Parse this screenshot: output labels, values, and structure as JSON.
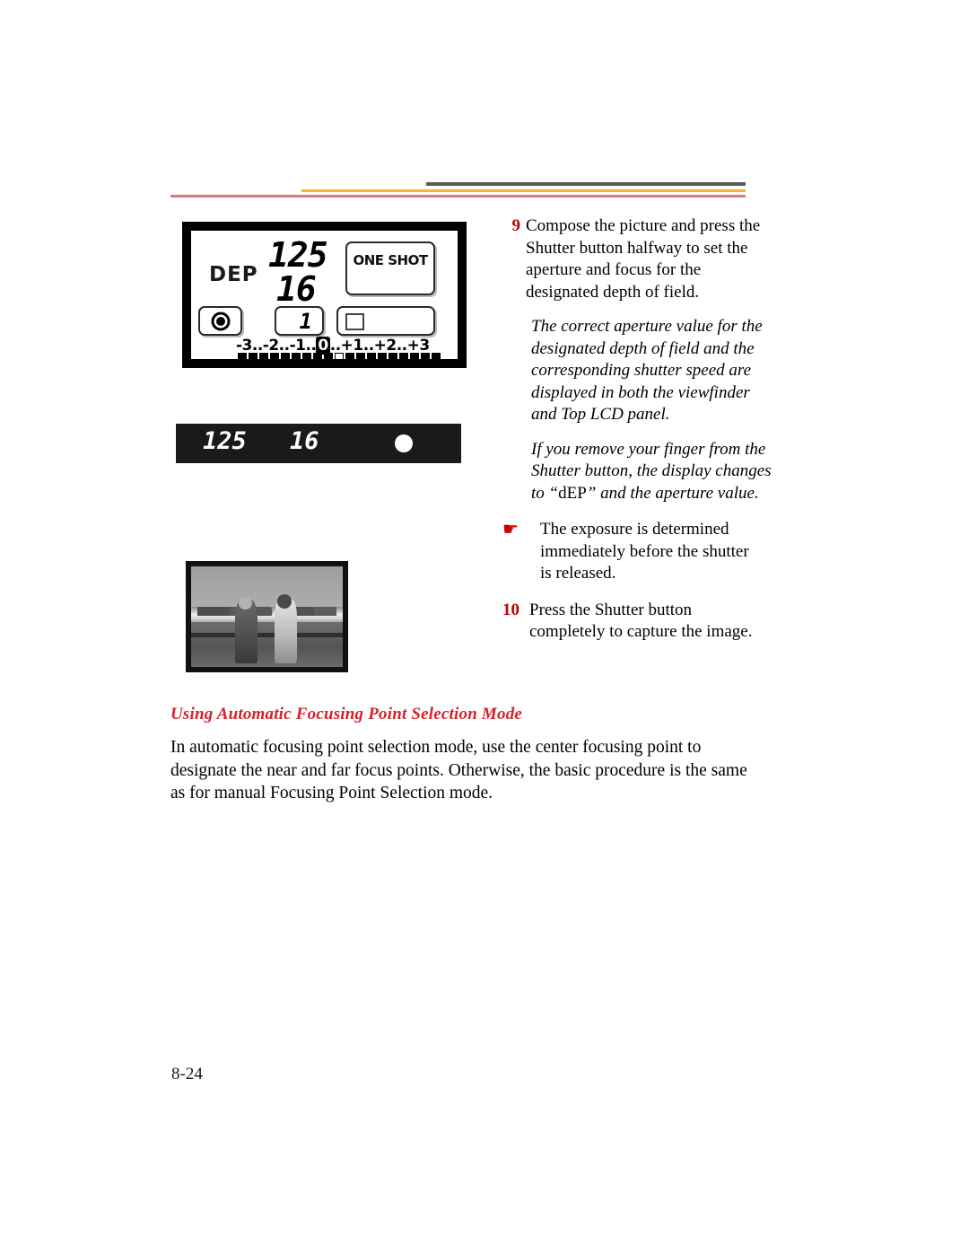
{
  "header": {
    "rule_gray_color": "#5a5a5a",
    "rule_yellow_color": "#f9b233",
    "rule_red_color": "#d9777c"
  },
  "lcd_panel": {
    "mode_label": "DEP",
    "shutter_speed": "125",
    "aperture": "16",
    "af_mode_label": "ONE SHOT",
    "frames_remaining": "1",
    "exposure_scale": {
      "left_part": "-3..-2..-1..",
      "zero": "0",
      "right_part": "..+1..+2..+3"
    }
  },
  "viewfinder": {
    "shutter_speed": "125",
    "aperture": "16"
  },
  "steps": [
    {
      "number": "9",
      "text": "Compose the picture and press the Shutter button halfway to set the aperture and focus for the designated depth of field."
    }
  ],
  "notes": [
    {
      "text": "The correct aperture value for the designated depth of field and the corresponding shutter speed are displayed in both the viewfinder and Top LCD panel."
    }
  ],
  "note_with_quote": {
    "before": "If you remove your finger from the Shutter button, the display changes to “",
    "quoted": "dEP",
    "after": "” and the aperture value."
  },
  "bullet": {
    "glyph": "☛",
    "text": "The exposure is determined immediately before the shutter is released."
  },
  "step_ten": {
    "number": "10",
    "text": "Press the Shutter button completely to capture the image."
  },
  "section": {
    "heading": "Using Automatic Focusing Point Selection Mode",
    "body": "In automatic focusing point selection mode, use the center focusing point to designate the near and far focus points. Otherwise, the basic procedure is the same as for manual Focusing Point Selection mode."
  },
  "footer": {
    "page_number": "8-24"
  },
  "colors": {
    "step_number": "#c00000",
    "heading": "#d2232a",
    "bullet": "#cc0000"
  }
}
